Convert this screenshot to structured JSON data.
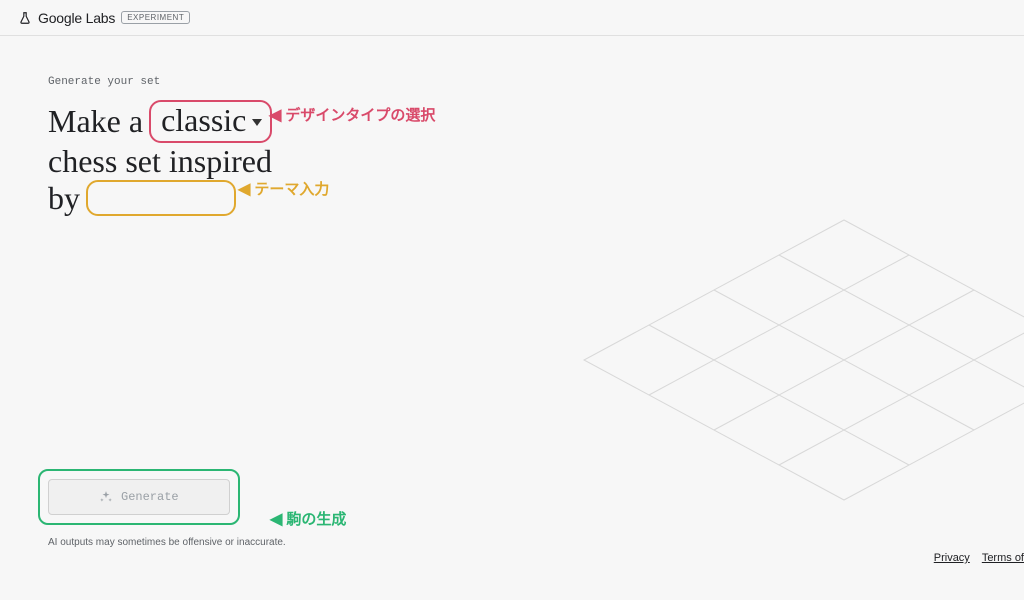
{
  "header": {
    "brand": "Google Labs",
    "badge": "EXPERIMENT"
  },
  "main": {
    "subtitle": "Generate your set",
    "prompt": {
      "part1": "Make a",
      "dropdown_value": "classic",
      "part2": "chess set inspired",
      "part3": "by",
      "input_value": ""
    },
    "annotations": {
      "design_type": "デザインタイプの選択",
      "theme_input": "テーマ入力",
      "generate": "駒の生成"
    }
  },
  "generate": {
    "button_label": "Generate"
  },
  "footer": {
    "disclaimer": "AI outputs may sometimes be offensive or inaccurate.",
    "privacy": "Privacy",
    "terms": "Terms of"
  }
}
